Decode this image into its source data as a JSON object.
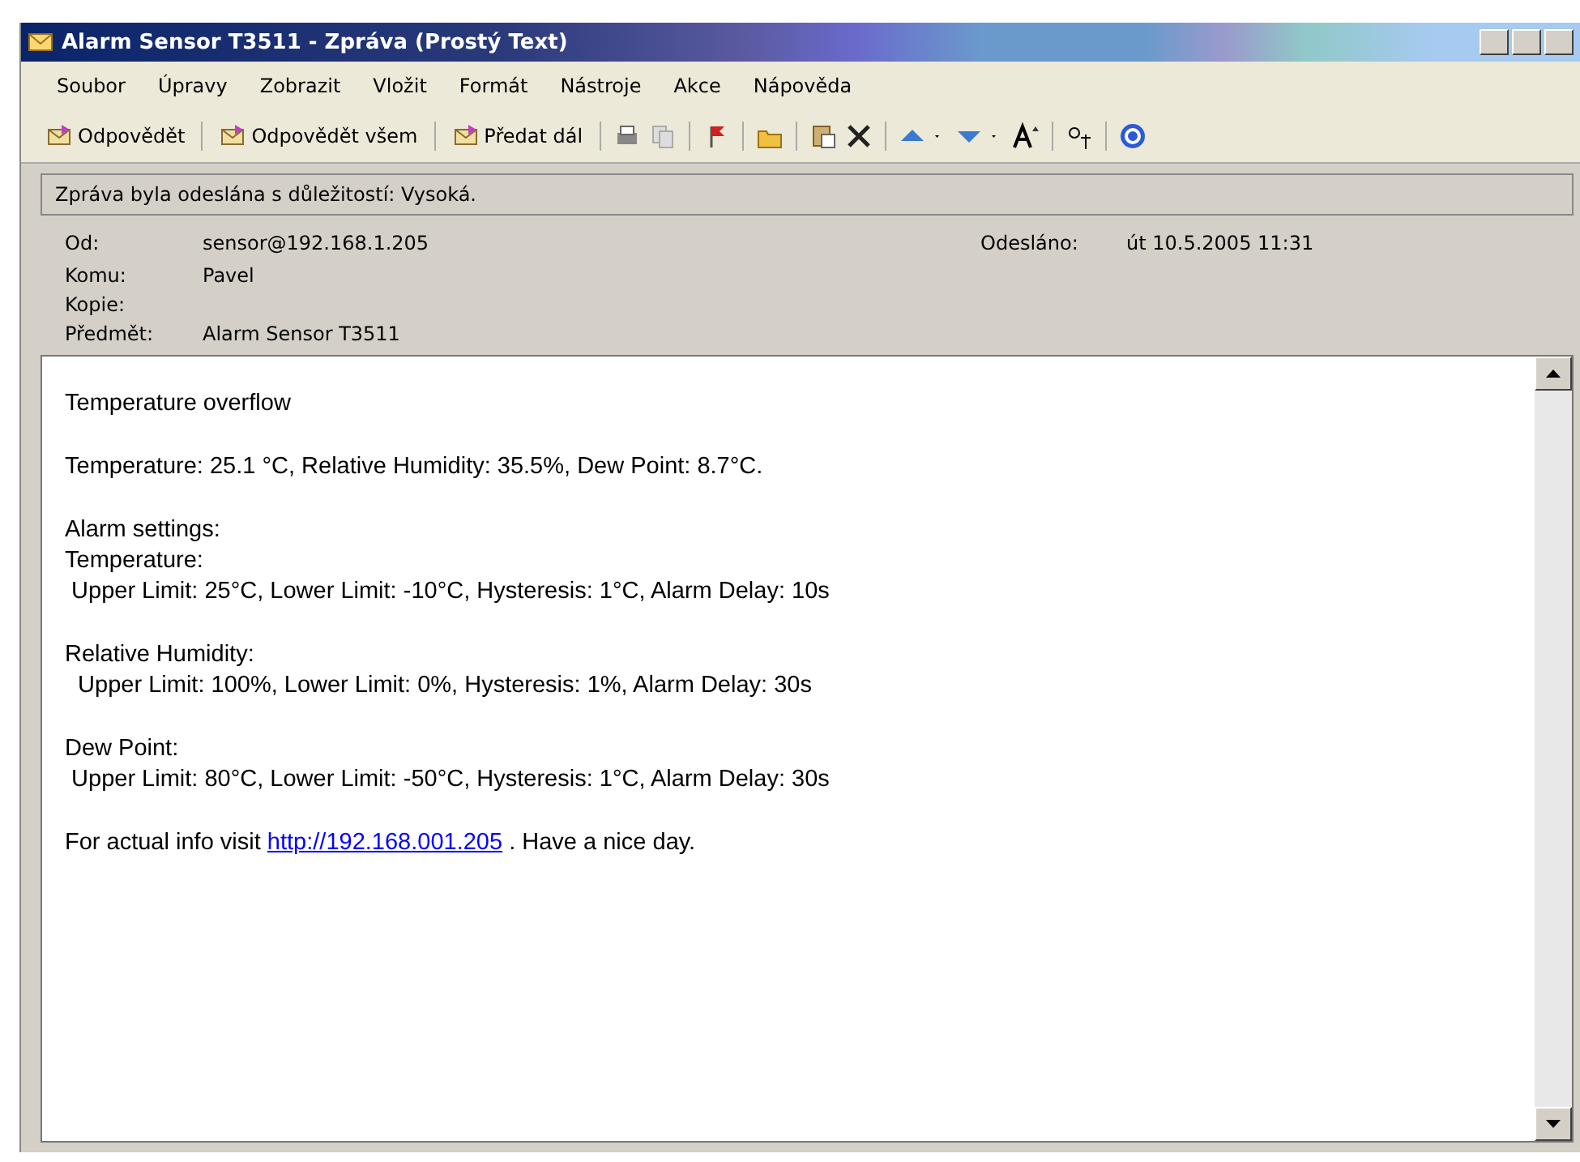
{
  "window": {
    "title": "Alarm Sensor T3511 - Zpráva (Prostý Text)"
  },
  "menu": [
    "Soubor",
    "Úpravy",
    "Zobrazit",
    "Vložit",
    "Formát",
    "Nástroje",
    "Akce",
    "Nápověda"
  ],
  "toolbar": {
    "buttons": [
      "Odpovědět",
      "Odpovědět všem",
      "Předat dál"
    ]
  },
  "info_bar": "Zpráva byla odeslána s důležitostí: Vysoká.",
  "header": {
    "from_label": "Od:",
    "from": "sensor@192.168.1.205",
    "sent_label": "Odesláno:",
    "sent": "út 10.5.2005 11:31",
    "fields": [
      {
        "label": "Komu:",
        "value": "Pavel"
      },
      {
        "label": "Kopie:"
      },
      {
        "label": "Předmět:",
        "value": "Alarm Sensor T3511"
      }
    ]
  },
  "body": {
    "paragraphs": [
      [
        "Temperature overflow"
      ],
      [
        "Temperature: 25.1 °C, Relative Humidity: 35.5%, Dew Point: 8.7°C."
      ],
      [
        "Alarm settings:",
        "Temperature:",
        " Upper Limit: 25°C, Lower Limit: -10°C, Hysteresis: 1°C, Alarm Delay: 10s"
      ],
      [
        "Relative Humidity:",
        "  Upper Limit: 100%, Lower Limit: 0%, Hysteresis: 1%, Alarm Delay: 30s"
      ],
      [
        "Dew Point:",
        " Upper Limit: 80°C, Lower Limit: -50°C, Hysteresis: 1°C, Alarm Delay: 30s"
      ]
    ],
    "footer": {
      "before": "For actual info visit",
      "link": "http://192.168.001.205",
      "after": ". Have a nice day."
    }
  }
}
